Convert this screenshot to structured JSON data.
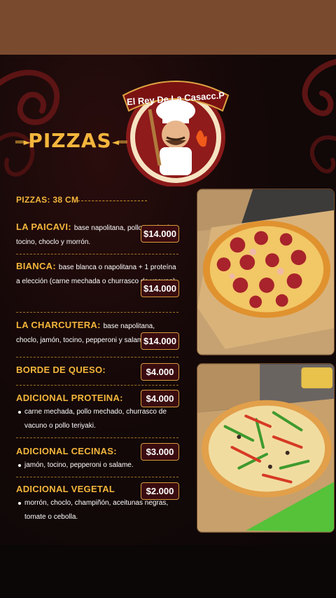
{
  "brand": {
    "name": "El Rey De La Casacc.P"
  },
  "header": {
    "title": "PIZZAS",
    "subtitle": "PIZZAS: 38 CM"
  },
  "items": [
    {
      "name": "LA PAICAVI:",
      "desc": "base napolitana, pollo mechado, tocino, choclo y morrón.",
      "price": "$14.000"
    },
    {
      "name": "BIANCA:",
      "desc": "base blanca o napolitana + 1 proteína a elección (carne mechada o churrasco de vacuno)",
      "price": "$14.000"
    },
    {
      "name": "LA CHARCUTERA:",
      "desc": "base napolitana, choclo, jamón, tocino, pepperoni y salame.",
      "price": "$14.000"
    },
    {
      "name": "BORDE DE QUESO:",
      "desc": "",
      "price": "$4.000"
    },
    {
      "name": "ADICIONAL PROTEINA:",
      "desc": "carne mechada, pollo mechado, churrasco de vacuno o pollo teriyaki.",
      "price": "$4.000"
    },
    {
      "name": "ADICIONAL CECINAS:",
      "desc": "jamón, tocino, pepperoni o salame.",
      "price": "$3.000"
    },
    {
      "name": "ADICIONAL VEGETAL",
      "desc": "morrón, choclo, champiñón, aceitunas negras, tomate o cebolla.",
      "price": "$2.000"
    }
  ],
  "colors": {
    "accent": "#f4b63c",
    "price_bg": "#3a0c10",
    "top_bar": "#7a4a2f",
    "background": "#140808"
  },
  "images": {
    "photo1": "pepperoni-pizza-in-box",
    "photo2": "vegetable-pizza-in-box"
  }
}
